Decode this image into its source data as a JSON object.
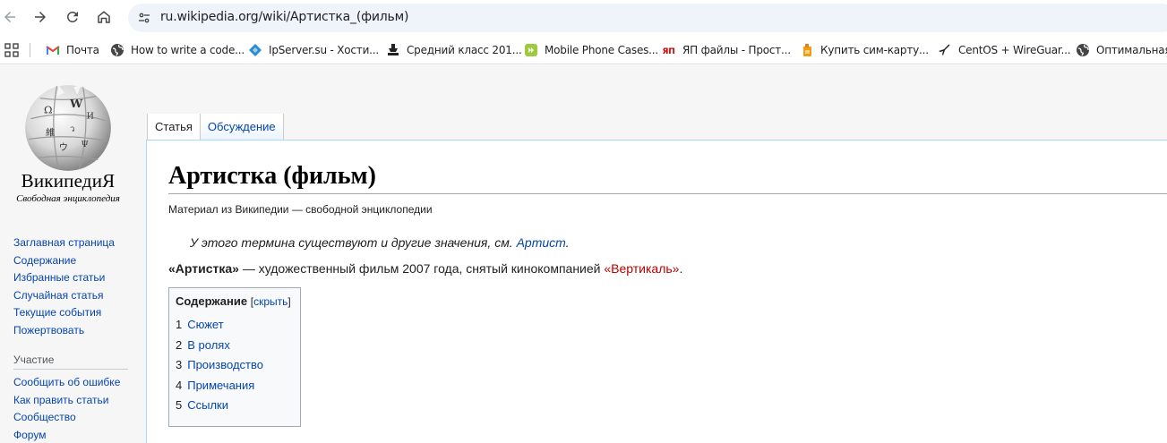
{
  "browser": {
    "url": "ru.wikipedia.org/wiki/Артистка_(фильм)",
    "bookmarks": [
      {
        "label": "Почта",
        "icon": "gmail-icon"
      },
      {
        "label": "How to write a code...",
        "icon": "globe-icon"
      },
      {
        "label": "IpServer.su - Хости...",
        "icon": "ipserver-icon"
      },
      {
        "label": "Средний класс 201...",
        "icon": "stamp-icon"
      },
      {
        "label": "Mobile Phone Cases...",
        "icon": "mobile-cases-icon"
      },
      {
        "label": "ЯП файлы - Прост...",
        "icon": "yap-icon"
      },
      {
        "label": "Купить сим-карту...",
        "icon": "sim-card-icon"
      },
      {
        "label": "CentOS + WireGuar...",
        "icon": "plane-icon"
      },
      {
        "label": "Оптимальная н",
        "icon": "globe-icon"
      }
    ]
  },
  "logo": {
    "wordmark": "ВикипедиЯ",
    "tagline": "Свободная энциклопедия"
  },
  "sidebar": {
    "navigation": [
      "Заглавная страница",
      "Содержание",
      "Избранные статьи",
      "Случайная статья",
      "Текущие события",
      "Пожертвовать"
    ],
    "participation_heading": "Участие",
    "participation": [
      "Сообщить об ошибке",
      "Как править статьи",
      "Сообщество",
      "Форум"
    ]
  },
  "tabs": [
    {
      "label": "Статья",
      "selected": true
    },
    {
      "label": "Обсуждение",
      "selected": false
    }
  ],
  "article": {
    "title": "Артистка (фильм)",
    "site_sub": "Материал из Википедии — свободной энциклопедии",
    "hatnote_text": "У этого термина существуют и другие значения, см. ",
    "hatnote_link": "Артист",
    "hatnote_end": ".",
    "lead_bold": "«Артистка»",
    "lead_text": " — художественный фильм 2007 года, снятый кинокомпанией ",
    "lead_link": "«Вертикаль»",
    "lead_end": "."
  },
  "toc": {
    "title": "Содержание",
    "hide_open": "[",
    "hide_label": "скрыть",
    "hide_close": "]",
    "items": [
      {
        "num": "1",
        "label": "Сюжет"
      },
      {
        "num": "2",
        "label": "В ролях"
      },
      {
        "num": "3",
        "label": "Производство"
      },
      {
        "num": "4",
        "label": "Примечания"
      },
      {
        "num": "5",
        "label": "Ссылки"
      }
    ]
  },
  "colors": {
    "link": "#0645ad",
    "new_link": "#ba0000",
    "omnibox_bg": "#eff3fa"
  }
}
